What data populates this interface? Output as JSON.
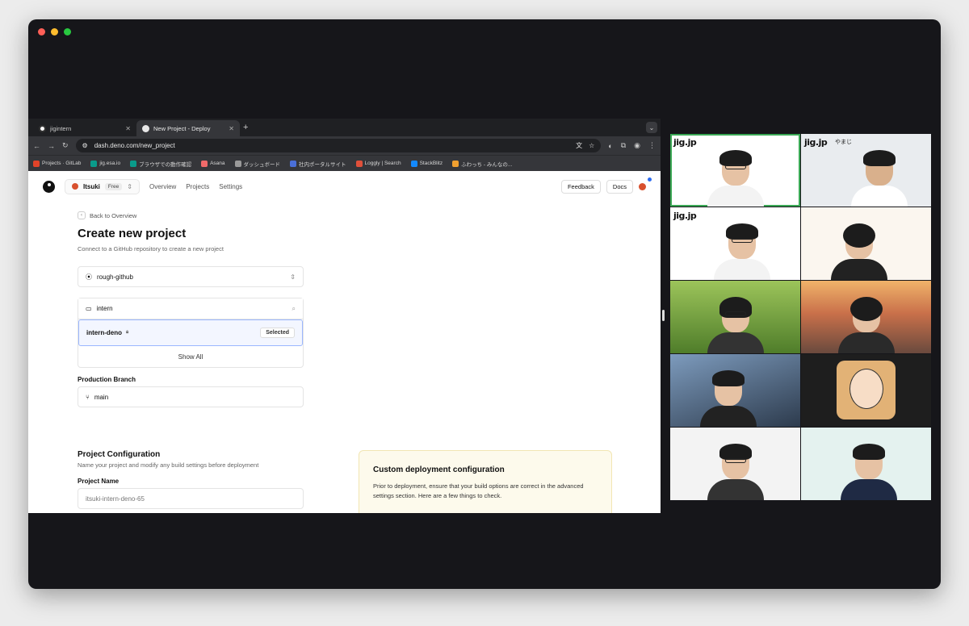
{
  "browser": {
    "tabs": [
      {
        "title": "jigintern",
        "active": false
      },
      {
        "title": "New Project - Deploy",
        "active": true
      }
    ],
    "url": "dash.deno.com/new_project",
    "bookmarks": [
      {
        "label": "Projects · GitLab",
        "color": "#e24329"
      },
      {
        "label": "jig.esa.io",
        "color": "#0a9b8b"
      },
      {
        "label": "ブラウザでの動作確認",
        "color": "#0a9b8b"
      },
      {
        "label": "Asana",
        "color": "#f06a6a"
      },
      {
        "label": "ダッシュボード",
        "color": "#9a9a9a"
      },
      {
        "label": "社内ポータルサイト",
        "color": "#4a6fd8"
      },
      {
        "label": "Loggly | Search",
        "color": "#e0503a"
      },
      {
        "label": "StackBlitz",
        "color": "#1389fd"
      },
      {
        "label": "ふわっち - みんなの...",
        "color": "#f0a030"
      }
    ]
  },
  "header": {
    "org_name": "Itsuki",
    "plan": "Free",
    "nav": [
      "Overview",
      "Projects",
      "Settings"
    ],
    "feedback": "Feedback",
    "docs": "Docs"
  },
  "main": {
    "back": "Back to Overview",
    "title": "Create new project",
    "subtitle": "Connect to a GitHub repository to create a new project",
    "github_account": "rough-github",
    "repo_search": "intern",
    "repo_selected": "intern-deno",
    "selected_label": "Selected",
    "show_all": "Show All",
    "branch_label": "Production Branch",
    "branch": "main",
    "config_title": "Project Configuration",
    "config_sub": "Name your project and modify any build settings before deployment",
    "name_label": "Project Name",
    "name_placeholder": "itsuki-intern-deno-65"
  },
  "custom": {
    "title": "Custom deployment configuration",
    "text": "Prior to deployment, ensure that your build options are correct in the advanced settings section. Here are a few things to check."
  },
  "video": {
    "tiles": [
      {
        "label": "jig.jp",
        "name": "",
        "bg": "#ffffff"
      },
      {
        "label": "jig.jp",
        "name": "やまじ",
        "bg": "#e9ecef"
      },
      {
        "label": "jig.jp",
        "name": "",
        "bg": "#ffffff"
      },
      {
        "label": "",
        "name": "",
        "bg": "#fbf6ef"
      },
      {
        "label": "",
        "name": "",
        "bg": "#7aa846"
      },
      {
        "label": "",
        "name": "",
        "bg": "#a56a4a"
      },
      {
        "label": "",
        "name": "",
        "bg": "#5e7a98"
      },
      {
        "label": "",
        "name": "",
        "bg": "#1e1e1e"
      },
      {
        "label": "",
        "name": "",
        "bg": "#f3f3f3"
      },
      {
        "label": "",
        "name": "",
        "bg": "#e4f2ef"
      }
    ]
  }
}
